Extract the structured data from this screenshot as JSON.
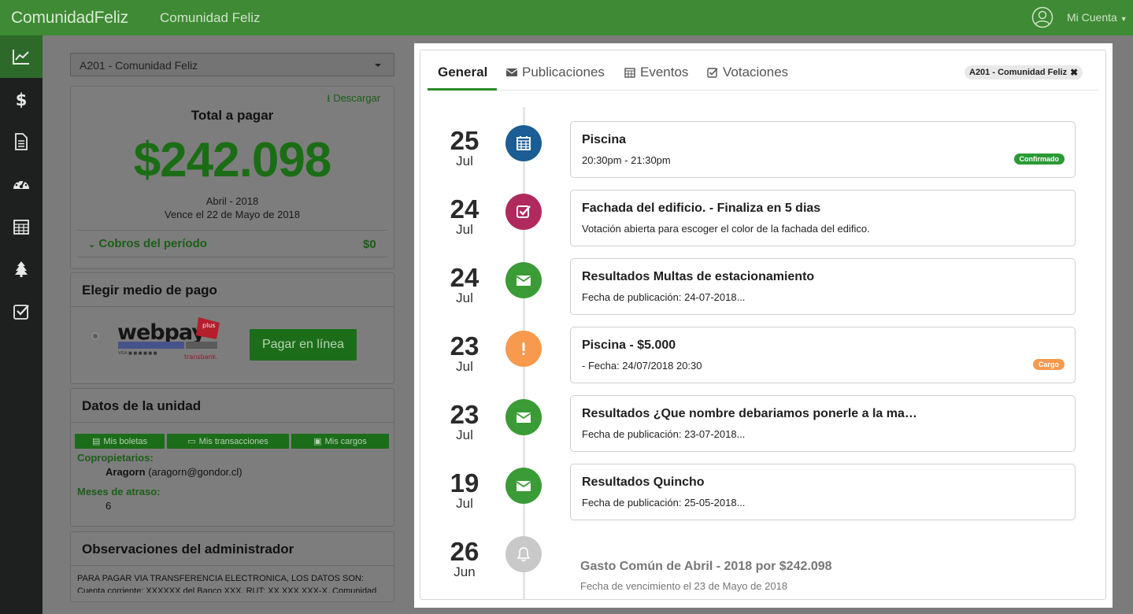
{
  "header": {
    "brand": "ComunidadFeliz",
    "community": "Comunidad Feliz",
    "account": "Mi Cuenta"
  },
  "sidebar": {
    "icons": [
      "chart-line-icon",
      "dollar-icon",
      "document-icon",
      "dashboard-icon",
      "calendar-icon",
      "tree-icon",
      "check-square-icon"
    ],
    "active_index": 0
  },
  "left": {
    "unit_select": "A201 - Comunidad Feliz",
    "download": "Descargar",
    "total_label": "Total a pagar",
    "total_amount": "$242.098",
    "period": "Abril - 2018",
    "due": "Vence el 22 de Mayo de 2018",
    "cobros_label": "Cobros del período",
    "cobros_value": "$0",
    "payment_heading": "Elegir medio de pago",
    "webpay_logo": "webpay",
    "webpay_plus": "plus",
    "webpay_brand": "transbank.",
    "pay_button": "Pagar en línea",
    "unit_heading": "Datos de la unidad",
    "unit_buttons": [
      "Mis boletas",
      "Mis transacciones",
      "Mis cargos"
    ],
    "owners_label": "Copropietarios:",
    "owner_name": "Aragorn",
    "owner_email": "(aragorn@gondor.cl)",
    "months_label": "Meses de atraso:",
    "months_value": "6",
    "obs_heading": "Observaciones del administrador",
    "obs_text": "PARA PAGAR VIA TRANSFERENCIA ELECTRONICA, LOS DATOS SON: Cuenta corriente: XXXXXX del Banco XXX, RUT: XX.XXX.XXX-X, Comunidad"
  },
  "modal": {
    "tabs": [
      {
        "label": "General",
        "icon": "",
        "active": true
      },
      {
        "label": "Publicaciones",
        "icon": "envelope-icon",
        "active": false
      },
      {
        "label": "Eventos",
        "icon": "calendar-icon",
        "active": false
      },
      {
        "label": "Votaciones",
        "icon": "check-square-icon",
        "active": false
      }
    ],
    "filter_badge": "A201 - Comunidad Feliz",
    "timeline": [
      {
        "day": "25",
        "month": "Jul",
        "icon": "calendar-icon",
        "color": "#1b5d94",
        "title": "Piscina",
        "subtitle": "20:30pm - 21:30pm",
        "badge": "Confirmado",
        "badge_color": "#2a9a35"
      },
      {
        "day": "24",
        "month": "Jul",
        "icon": "check-square-icon",
        "color": "#b02a5e",
        "title": "Fachada del edificio. - Finaliza en 5 dias",
        "subtitle": "Votación abierta para escoger el color de la fachada del edifico.",
        "badge": "",
        "badge_color": ""
      },
      {
        "day": "24",
        "month": "Jul",
        "icon": "envelope-icon",
        "color": "#3b9b36",
        "title": "Resultados Multas de estacionamiento",
        "subtitle": "Fecha de publicación: 24-07-2018...",
        "badge": "",
        "badge_color": ""
      },
      {
        "day": "23",
        "month": "Jul",
        "icon": "exclamation-icon",
        "color": "#f79a4e",
        "title": "Piscina - $5.000",
        "subtitle": "- Fecha: 24/07/2018 20:30",
        "badge": "Cargo",
        "badge_color": "#f79a4e"
      },
      {
        "day": "23",
        "month": "Jul",
        "icon": "envelope-icon",
        "color": "#3b9b36",
        "title": "Resultados ¿Que nombre debariamos ponerle a la ma…",
        "subtitle": "Fecha de publicación: 23-07-2018...",
        "badge": "",
        "badge_color": ""
      },
      {
        "day": "19",
        "month": "Jul",
        "icon": "envelope-icon",
        "color": "#3b9b36",
        "title": "Resultados Quincho",
        "subtitle": "Fecha de publicación: 25-05-2018...",
        "badge": "",
        "badge_color": ""
      },
      {
        "day": "26",
        "month": "Jun",
        "icon": "bell-icon",
        "color": "#c9c9c9",
        "title": "Gasto Común de Abril - 2018 por $242.098",
        "subtitle": "Fecha de vencimiento el 23 de Mayo de 2018",
        "badge": "",
        "badge_color": "",
        "plain": true
      }
    ]
  }
}
